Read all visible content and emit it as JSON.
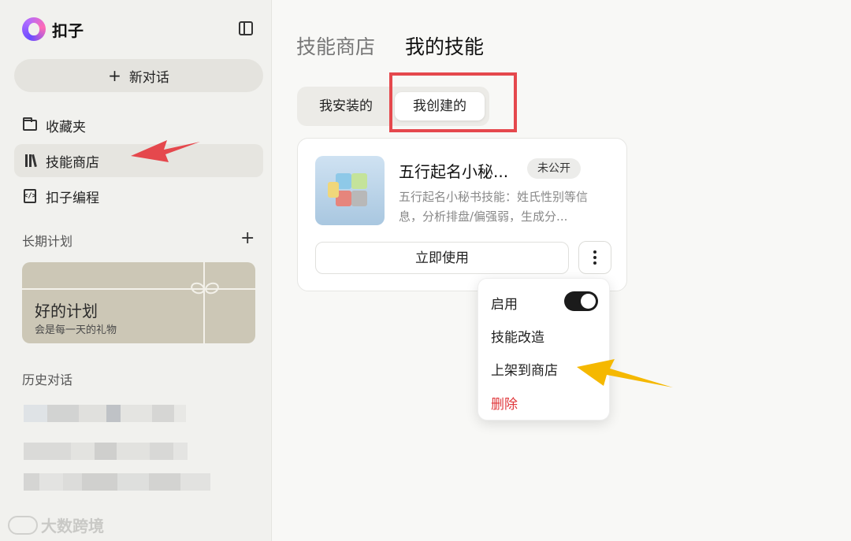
{
  "sidebar": {
    "brand": "扣子",
    "new_chat": "新对话",
    "items": [
      {
        "label": "收藏夹"
      },
      {
        "label": "技能商店"
      },
      {
        "label": "扣子编程"
      }
    ],
    "long_term_plan": {
      "title": "长期计划",
      "card_title": "好的计划",
      "card_subtitle": "会是每一天的礼物"
    },
    "history_title": "历史对话"
  },
  "main": {
    "tabs": [
      "技能商店",
      "我的技能"
    ],
    "subtabs": [
      "我安装的",
      "我创建的"
    ],
    "skill": {
      "name": "五行起名小秘...",
      "badge": "未公开",
      "description": "五行起名小秘书技能：姓氏性别等信息，分析排盘/偏强弱，生成分...",
      "use_button": "立即使用"
    },
    "menu": {
      "enable": "启用",
      "enabled": true,
      "improve": "技能改造",
      "publish": "上架到商店",
      "delete": "删除"
    }
  },
  "watermark": "大数跨境",
  "colors": {
    "annotation_red": "#e5484d",
    "annotation_yellow": "#f5b800",
    "delete_red": "#e0373b",
    "card_bg": "#ccc7b6"
  }
}
